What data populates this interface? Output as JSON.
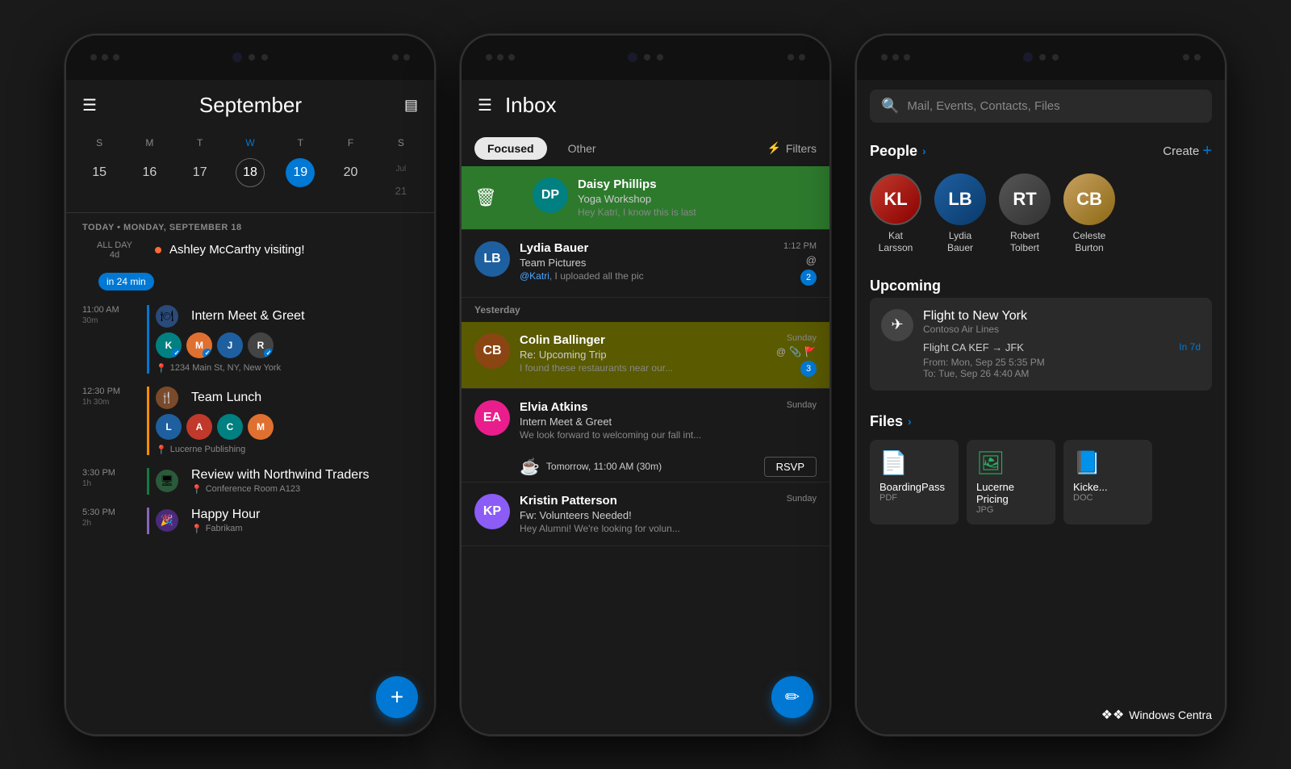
{
  "phone1": {
    "month": "September",
    "icon_hamburger": "☰",
    "icon_grid": "▤",
    "days": [
      "S",
      "M",
      "T",
      "W",
      "T",
      "F",
      "S"
    ],
    "week_dates": [
      "15",
      "16",
      "17",
      "18",
      "19",
      "20",
      ""
    ],
    "jul_label": "Jul",
    "jul_date": "21",
    "today_label": "TODAY • MONDAY, SEPTEMBER 18",
    "allday_label": "ALL DAY",
    "allday_duration": "4d",
    "allday_event": "Ashley McCarthy visiting!",
    "badge_label": "in 24 min",
    "events": [
      {
        "time": "11:00 AM",
        "duration": "30m",
        "title": "Intern Meet & Greet",
        "location": "1234 Main St, NY, New York",
        "color": "blue"
      },
      {
        "time": "12:30 PM",
        "duration": "1h 30m",
        "title": "Team Lunch",
        "location": "Lucerne Publishing",
        "color": "orange"
      },
      {
        "time": "3:30 PM",
        "duration": "1h",
        "title": "Review with Northwind Traders",
        "location": "Conference Room A123",
        "color": "green"
      },
      {
        "time": "5:30 PM",
        "duration": "2h",
        "title": "Happy Hour",
        "location": "Fabrikam",
        "color": "purple"
      }
    ],
    "fab_icon": "+"
  },
  "phone2": {
    "title": "Inbox",
    "icon_hamburger": "☰",
    "tab_focused": "Focused",
    "tab_other": "Other",
    "filters_label": "Filters",
    "section_yesterday": "Yesterday",
    "emails": [
      {
        "sender": "Daisy Phillips",
        "subject": "Yoga Workshop",
        "preview": "Hey Katri, I know this is last",
        "time": "",
        "swipe": true,
        "avatar_color": "teal",
        "avatar_initials": "DP"
      },
      {
        "sender": "Lydia Bauer",
        "subject": "Team Pictures",
        "preview": "@Katri, I uploaded all the pic",
        "time": "1:12 PM",
        "has_at": true,
        "badge": "2",
        "avatar_color": "blue",
        "avatar_initials": "LB"
      },
      {
        "sender": "Colin Ballinger",
        "subject": "Re: Upcoming Trip",
        "preview": "I found these restaurants near our...",
        "time": "Sunday",
        "has_at": true,
        "has_attach": true,
        "has_flag": true,
        "badge": "3",
        "highlighted": true,
        "avatar_color": "brown",
        "avatar_initials": "CB"
      },
      {
        "sender": "Elvia Atkins",
        "subject": "Intern Meet & Greet",
        "preview": "We look forward to welcoming our fall int...",
        "time": "Sunday",
        "avatar_color": "pink",
        "avatar_initials": "EA",
        "has_rsvp": true,
        "rsvp_text": "Tomorrow, 11:00 AM (30m)"
      },
      {
        "sender": "Kristin Patterson",
        "subject": "Fw: Volunteers Needed!",
        "preview": "Hey Alumni! We're looking for volun...",
        "time": "Sunday",
        "avatar_color": "purple",
        "avatar_initials": "KP"
      }
    ],
    "fab_icon": "✏"
  },
  "phone3": {
    "search_placeholder": "Mail, Events, Contacts, Files",
    "people_title": "People",
    "create_label": "Create",
    "people": [
      {
        "name": "Kat\nLarsson",
        "color": "red",
        "initials": "KL"
      },
      {
        "name": "Lydia\nBauer",
        "color": "blue",
        "initials": "LB"
      },
      {
        "name": "Robert\nTolbert",
        "color": "dark",
        "initials": "RT"
      },
      {
        "name": "Celeste\nBurton",
        "color": "teal",
        "initials": "CB"
      }
    ],
    "upcoming_title": "Upcoming",
    "flight_title": "Flight to New York",
    "flight_airline": "Contoso Air Lines",
    "flight_route": "Flight CA KEF → JFK",
    "flight_badge": "In 7d",
    "flight_from": "From: Mon, Sep 25 5:35 PM",
    "flight_to": "To: Tue, Sep 26 4:40 AM",
    "files_title": "Files",
    "files": [
      {
        "name": "BoardingPass",
        "type": "PDF",
        "icon": "📄",
        "color": "red"
      },
      {
        "name": "Lucerne Pricing",
        "type": "JPG",
        "icon": "🖼",
        "color": "green"
      },
      {
        "name": "Kicke...",
        "type": "DOC",
        "icon": "📘",
        "color": "blue"
      }
    ],
    "wc_text": "Windows Centra"
  }
}
